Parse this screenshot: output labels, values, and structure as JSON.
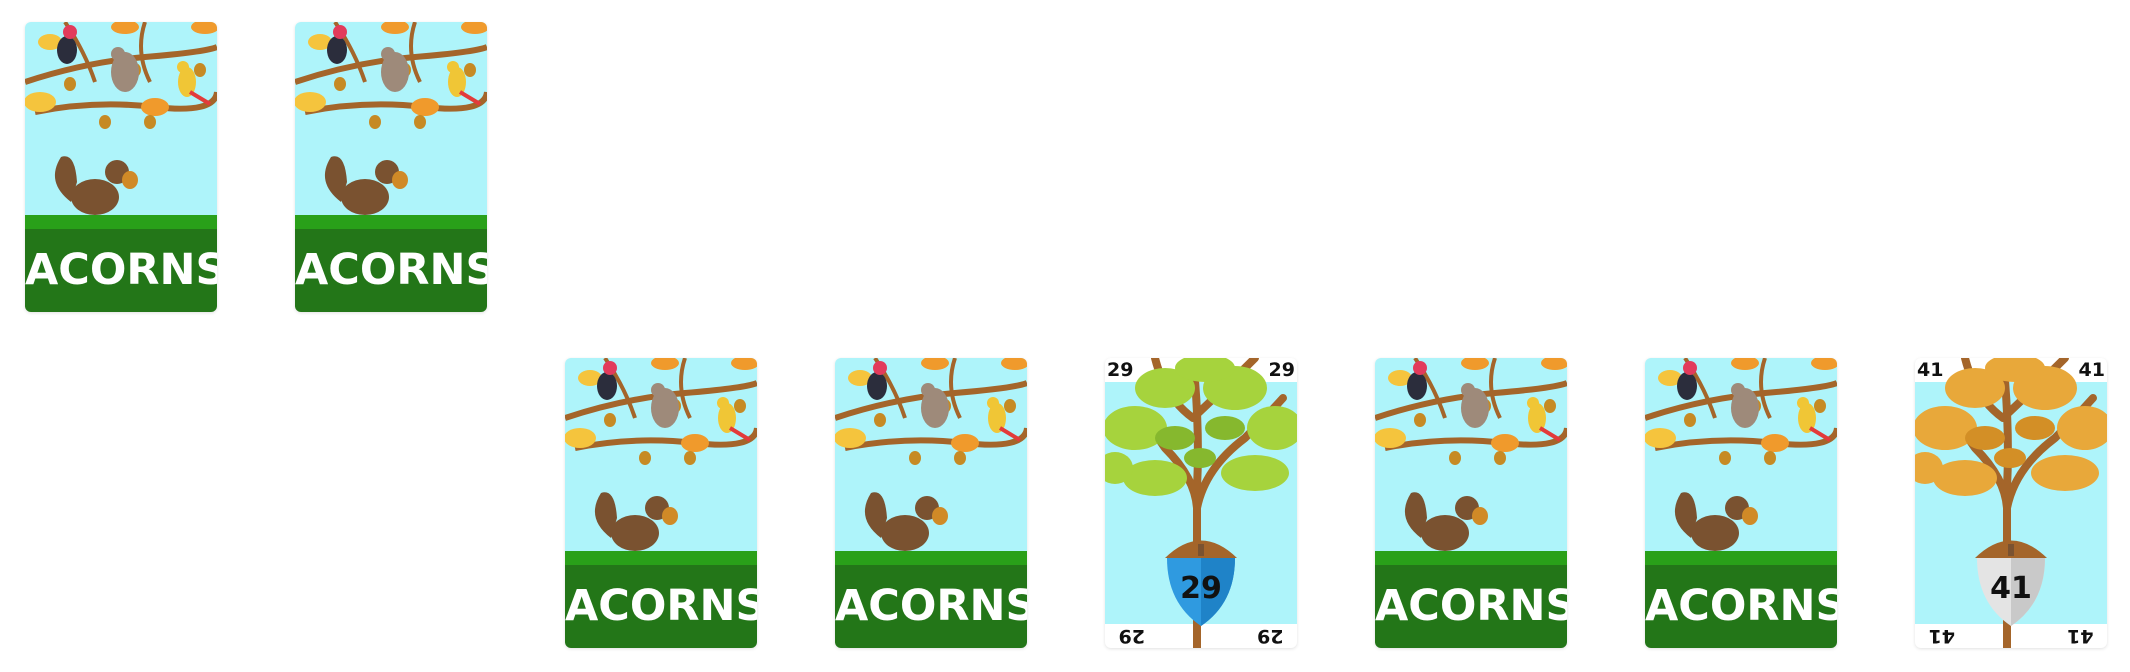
{
  "deck_back_label": "ACORNS",
  "cards": [
    {
      "id": "top-left-1",
      "type": "back"
    },
    {
      "id": "top-left-2",
      "type": "back"
    },
    {
      "id": "row-1",
      "type": "back"
    },
    {
      "id": "row-2",
      "type": "back"
    },
    {
      "id": "row-3",
      "type": "face",
      "value": "29",
      "corner": "29",
      "leaf_color": "#a6d33d",
      "acorn_color": "#2f9ae0"
    },
    {
      "id": "row-4",
      "type": "back"
    },
    {
      "id": "row-5",
      "type": "back"
    },
    {
      "id": "row-6",
      "type": "face",
      "value": "41",
      "corner": "41",
      "leaf_color": "#e8a83a",
      "acorn_color": "#d8d8d8"
    }
  ],
  "colors": {
    "sky": "#aef4fa",
    "grass": "#29a019",
    "label_bg": "#237618",
    "branch": "#a4652a"
  }
}
